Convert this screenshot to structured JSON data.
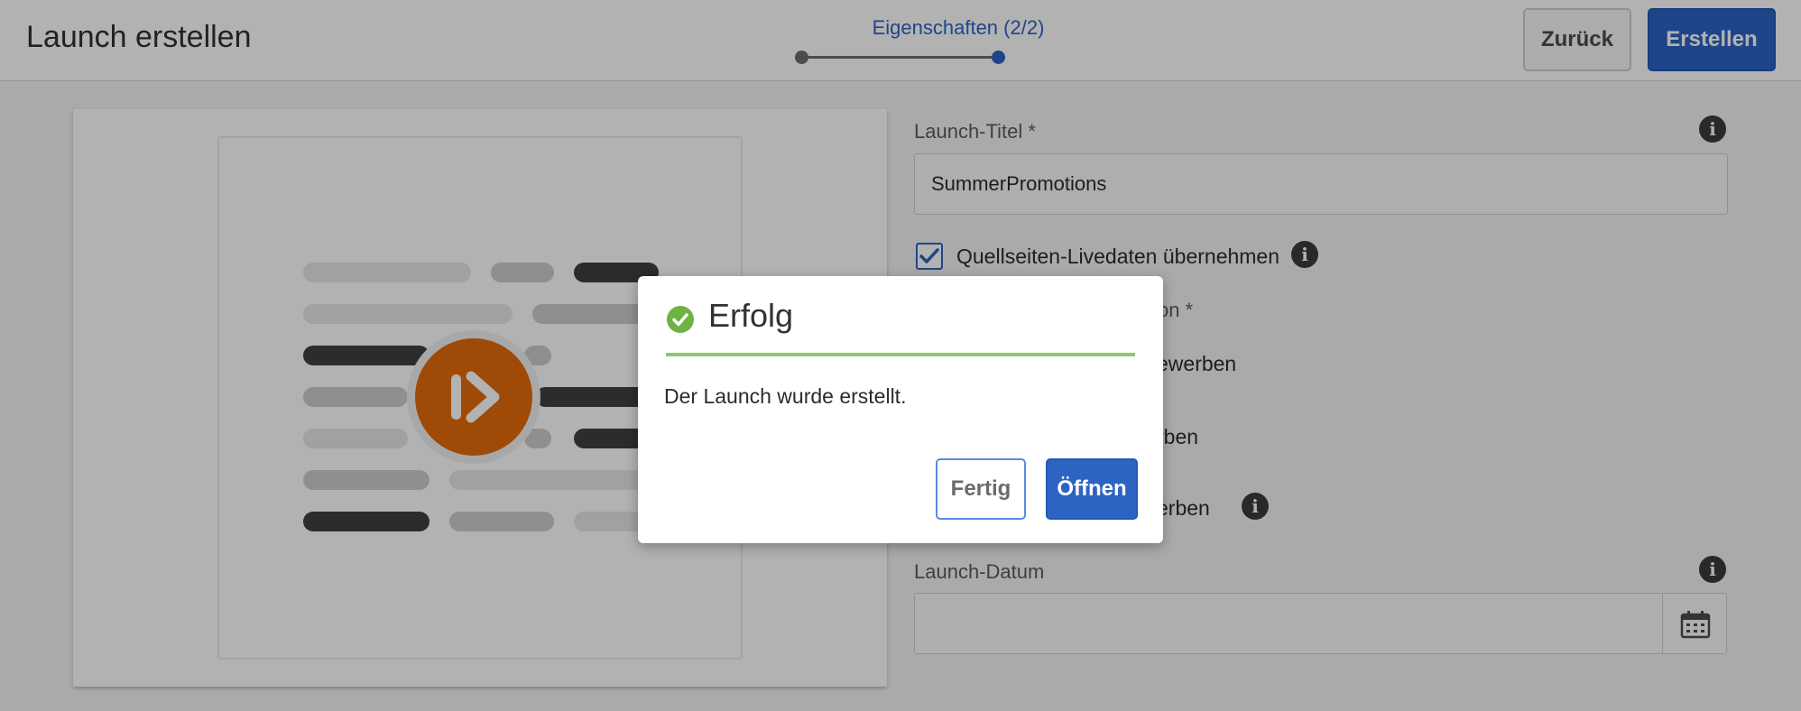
{
  "header": {
    "title": "Launch erstellen",
    "wizard_step_label": "Eigenschaften (2/2)",
    "back_label": "Zurück",
    "create_label": "Erstellen"
  },
  "form": {
    "launch_title_label": "Launch-Titel *",
    "launch_title_value": "SummerPromotions",
    "inherit_live_data_label": "Quellseiten-Livedaten übernehmen",
    "inherit_live_data_checked": true,
    "promotion_scope_label_partial": "on *",
    "option1_partial": "ewerben",
    "option2_partial": "rben",
    "option3_partial": "erben",
    "launch_date_label": "Launch-Datum",
    "launch_date_value": ""
  },
  "dialog": {
    "status": "success",
    "status_icon": "checkmark-circle-icon",
    "title": "Erfolg",
    "message": "Der Launch wurde erstellt.",
    "done_label": "Fertig",
    "open_label": "Öffnen"
  },
  "icons": {
    "info": "info-icon",
    "calendar": "calendar-icon",
    "launch": "launch-icon",
    "check": "checkmark-icon"
  },
  "colors": {
    "accent": "#2d64c4",
    "success": "#8cc96a",
    "launch_orange": "#e46a0a"
  }
}
